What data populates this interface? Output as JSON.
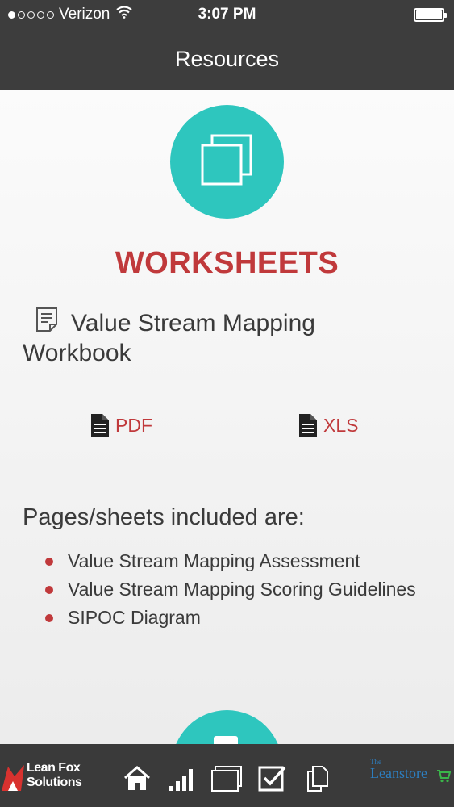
{
  "status": {
    "carrier": "Verizon",
    "time": "3:07 PM"
  },
  "nav": {
    "title": "Resources"
  },
  "section": {
    "heading": "WORKSHEETS",
    "doc_title": "Value Stream Mapping Workbook",
    "downloads": {
      "pdf_label": "PDF",
      "xls_label": "XLS"
    },
    "included_heading": "Pages/sheets included are:",
    "included_items": [
      "Value Stream Mapping Assessment",
      "Value Stream Mapping Scoring Guidelines",
      "SIPOC Diagram"
    ]
  },
  "tabbar": {
    "left_brand": {
      "line1": "Lean Fox",
      "line2": "Solutions"
    },
    "right_brand": {
      "small": "The",
      "name": "Leanstore"
    },
    "tabs": [
      {
        "icon": "home-icon"
      },
      {
        "icon": "signal-bars-icon"
      },
      {
        "icon": "stacked-windows-icon"
      },
      {
        "icon": "checkbox-icon"
      },
      {
        "icon": "documents-icon"
      }
    ]
  },
  "colors": {
    "accent": "#c0393b",
    "teal": "#2ec6be",
    "bar": "#3d3d3d"
  }
}
